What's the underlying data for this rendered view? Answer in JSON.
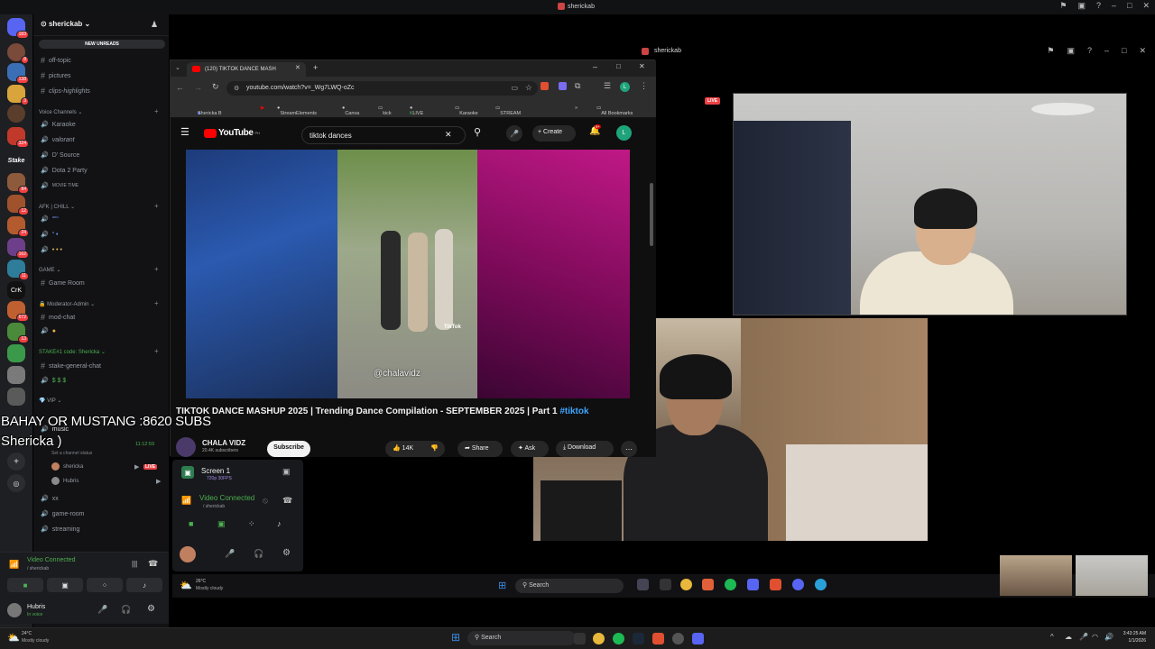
{
  "titlebar": {
    "title": "sherickab"
  },
  "rail": {
    "badges": [
      "183",
      "8",
      "138",
      "3",
      "324",
      "3",
      "84",
      "8",
      "12",
      "24",
      "162",
      "11",
      "23",
      "672",
      "13",
      "11"
    ],
    "stake_label": "Stake",
    "crk_label": "CrK"
  },
  "sidebar": {
    "server_name": "sherickab",
    "new_unreads": "NEW UNREADS",
    "channels_top": [
      "off-topic",
      "pictures",
      "clips-highlights"
    ],
    "voice_category": "Voice Channels",
    "voice_channels": [
      "Karaoke",
      "valorant",
      "D' Source",
      "Dota 2 Party",
      "MOVIE TIME"
    ],
    "afk_category": "AFK | CHILL",
    "afk_channels": [
      "“““",
      "“ •",
      "• • •"
    ],
    "game_category": "GAME",
    "game_channels": [
      "Game Room"
    ],
    "mod_category": "Moderator-Admin",
    "mod_channels": [
      "mod-chat",
      ""
    ],
    "stake_category": "STAKE#1 code: Shericka",
    "stake_channels": [
      "stake-general-chat",
      "$ $ $"
    ],
    "vip_category": "VIP",
    "music_channel": "music",
    "music_timer": "11:12:59",
    "channel_status": "Set a channel status",
    "voice_users": [
      {
        "name": "shericka",
        "live": "LIVE"
      },
      {
        "name": "Hubris",
        "live": ""
      }
    ],
    "more_channels": [
      "xx",
      "game-room",
      "streaming"
    ]
  },
  "voice_panel": {
    "status": "Video Connected",
    "server": "/ sherickab"
  },
  "user_panel": {
    "name": "Hubris",
    "status": "In voice"
  },
  "weather_outer": {
    "temp": "24°C",
    "desc": "Mostly cloudy"
  },
  "chrome": {
    "tab_title": "(120) TIKTOK DANCE MASH",
    "url": "youtube.com/watch?v=_Wg7LWQ-oZc",
    "bookmarks": [
      "Shericka B",
      "StreamElements",
      "Canva",
      "kick",
      "LIVE",
      "Karaoke",
      "STREAM"
    ],
    "all_bookmarks": "All Bookmarks",
    "avatar_letter": "L"
  },
  "youtube": {
    "logo": "YouTube",
    "logo_sup": "PH",
    "search_value": "tiktok dances",
    "create_label": "Create",
    "notif_count": "9+",
    "video_title": "TIKTOK DANCE MASHUP 2025 | Trending Dance Compilation - SEPTEMBER 2025 | Part 1",
    "video_hashtag": "#tiktok",
    "watermark": "@chalavidz",
    "tiktok_logo": "TikTok",
    "channel_name": "CHALA VIDZ",
    "channel_subs": "20.4K subscribers",
    "subscribe": "Subscribe",
    "likes": "14K",
    "share": "Share",
    "ask": "Ask",
    "download": "Download"
  },
  "screen_panel": {
    "screen_label": "Screen 1",
    "screen_sub": "720p 30FPS",
    "status": "Video Connected",
    "server": "/ sherickab"
  },
  "stream_window": {
    "title": "sherickab",
    "live": "LIVE"
  },
  "overlay": {
    "line1": "BAHAY OR MUSTANG :8620 SUBS",
    "line2": "Shericka )"
  },
  "inner_taskbar": {
    "temp": "26°C",
    "desc": "Mostly cloudy",
    "search": "Search"
  },
  "taskbar": {
    "search": "Search",
    "time": "3:43:25 AM",
    "date": "1/1/2026"
  }
}
